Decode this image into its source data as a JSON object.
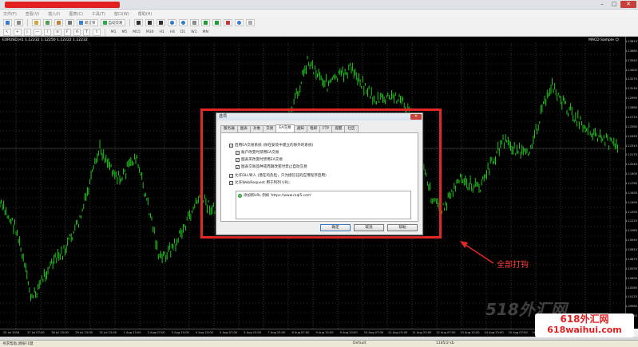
{
  "menu": {
    "items": [
      "文件(F)",
      "查看(V)",
      "插入(I)",
      "图表(C)",
      "工具(T)",
      "窗口(W)",
      "帮助(H)"
    ]
  },
  "toolbar": {
    "new_order_label": "新订单",
    "autotrading_label": "自动交易",
    "timeframes": [
      "M1",
      "M5",
      "M15",
      "M30",
      "H1",
      "H4",
      "D1",
      "W1",
      "MN"
    ]
  },
  "chart": {
    "symbol_info": "EURUSD,H1  1.12232  1.12250  1.12222  1.12232",
    "ea_label": "MACD Sample ☺",
    "price_ticks": [
      "1.13815",
      "1.13685",
      "1.13545",
      "1.13405",
      "1.13275",
      "1.13135",
      "1.12995",
      "1.12865",
      "1.12725",
      "1.12585",
      "1.12455",
      "1.12315",
      "1.12175",
      "1.12045",
      "1.11905",
      "1.11765",
      "1.11635",
      "1.11495",
      "1.11355",
      "1.11225",
      "1.11085",
      "1.10945",
      "1.10815",
      "1.10675",
      "1.10535",
      "1.10405",
      "1.10265",
      "1.10125",
      "1.09985",
      "1.09855"
    ],
    "time_ticks": [
      "25 Jul 2016",
      "27 Jul 07:00",
      "28 Jul 15:00",
      "29 Jul 23:00",
      "31 Jul 15:00",
      "1 Aug 23:00",
      "2 Aug 07:00",
      "3 Aug 15:00",
      "4 Aug 23:00",
      "5 Aug 07:00",
      "5 Aug 15:00",
      "7 Aug 23:00",
      "8 Aug 07:00",
      "9 Aug 15:00",
      "9 Aug 23:00",
      "10 Aug 07:00",
      "11 Aug 15:00",
      "11 Aug 23:00",
      "12 Aug 07:00",
      "13 Aug 15:00",
      "14 Aug 23:00",
      "15 Aug 07:00",
      "16 Aug 15:00",
      "16 Aug 23:00",
      "17 Aug 07:00"
    ],
    "line_color": "#22c41e"
  },
  "dialog": {
    "title": "选项",
    "close": "✕",
    "tabs": [
      "服务器",
      "图表",
      "对象",
      "交易",
      "EA交易",
      "通知",
      "电邮",
      "FTP",
      "提醒",
      "社区"
    ],
    "active_tab": 4,
    "options": [
      {
        "label": "启用EA交易系统 (除在安装中建立的除外的系统)",
        "checked": true
      },
      {
        "label": "账户改变时禁用EA交易",
        "checked": true
      },
      {
        "label": "图表夹改变时禁用EA交易",
        "checked": true
      },
      {
        "label": "图表交易品种或周期改变时禁止自动交易",
        "checked": true
      },
      {
        "label": "允许DLL导入 (潜在的危险，只为授信任的应用程序启用)",
        "checked": true
      },
      {
        "label": "允许WebRequest 用于列列 URL:",
        "checked": true
      }
    ],
    "url_add_text": "添加新URL 例如 'https://www.mql5.com'",
    "ok": "确定",
    "cancel": "取消",
    "help": "帮助"
  },
  "annotation": {
    "text": "全部打钩",
    "color": "#e32727"
  },
  "statusbar": {
    "left": "寻求帮助,请按F1键",
    "profile": "Default",
    "right": "1185/2 kb"
  },
  "watermark": {
    "big": "518外汇网",
    "line1": "618外汇网",
    "line2": "618waihui.com"
  }
}
